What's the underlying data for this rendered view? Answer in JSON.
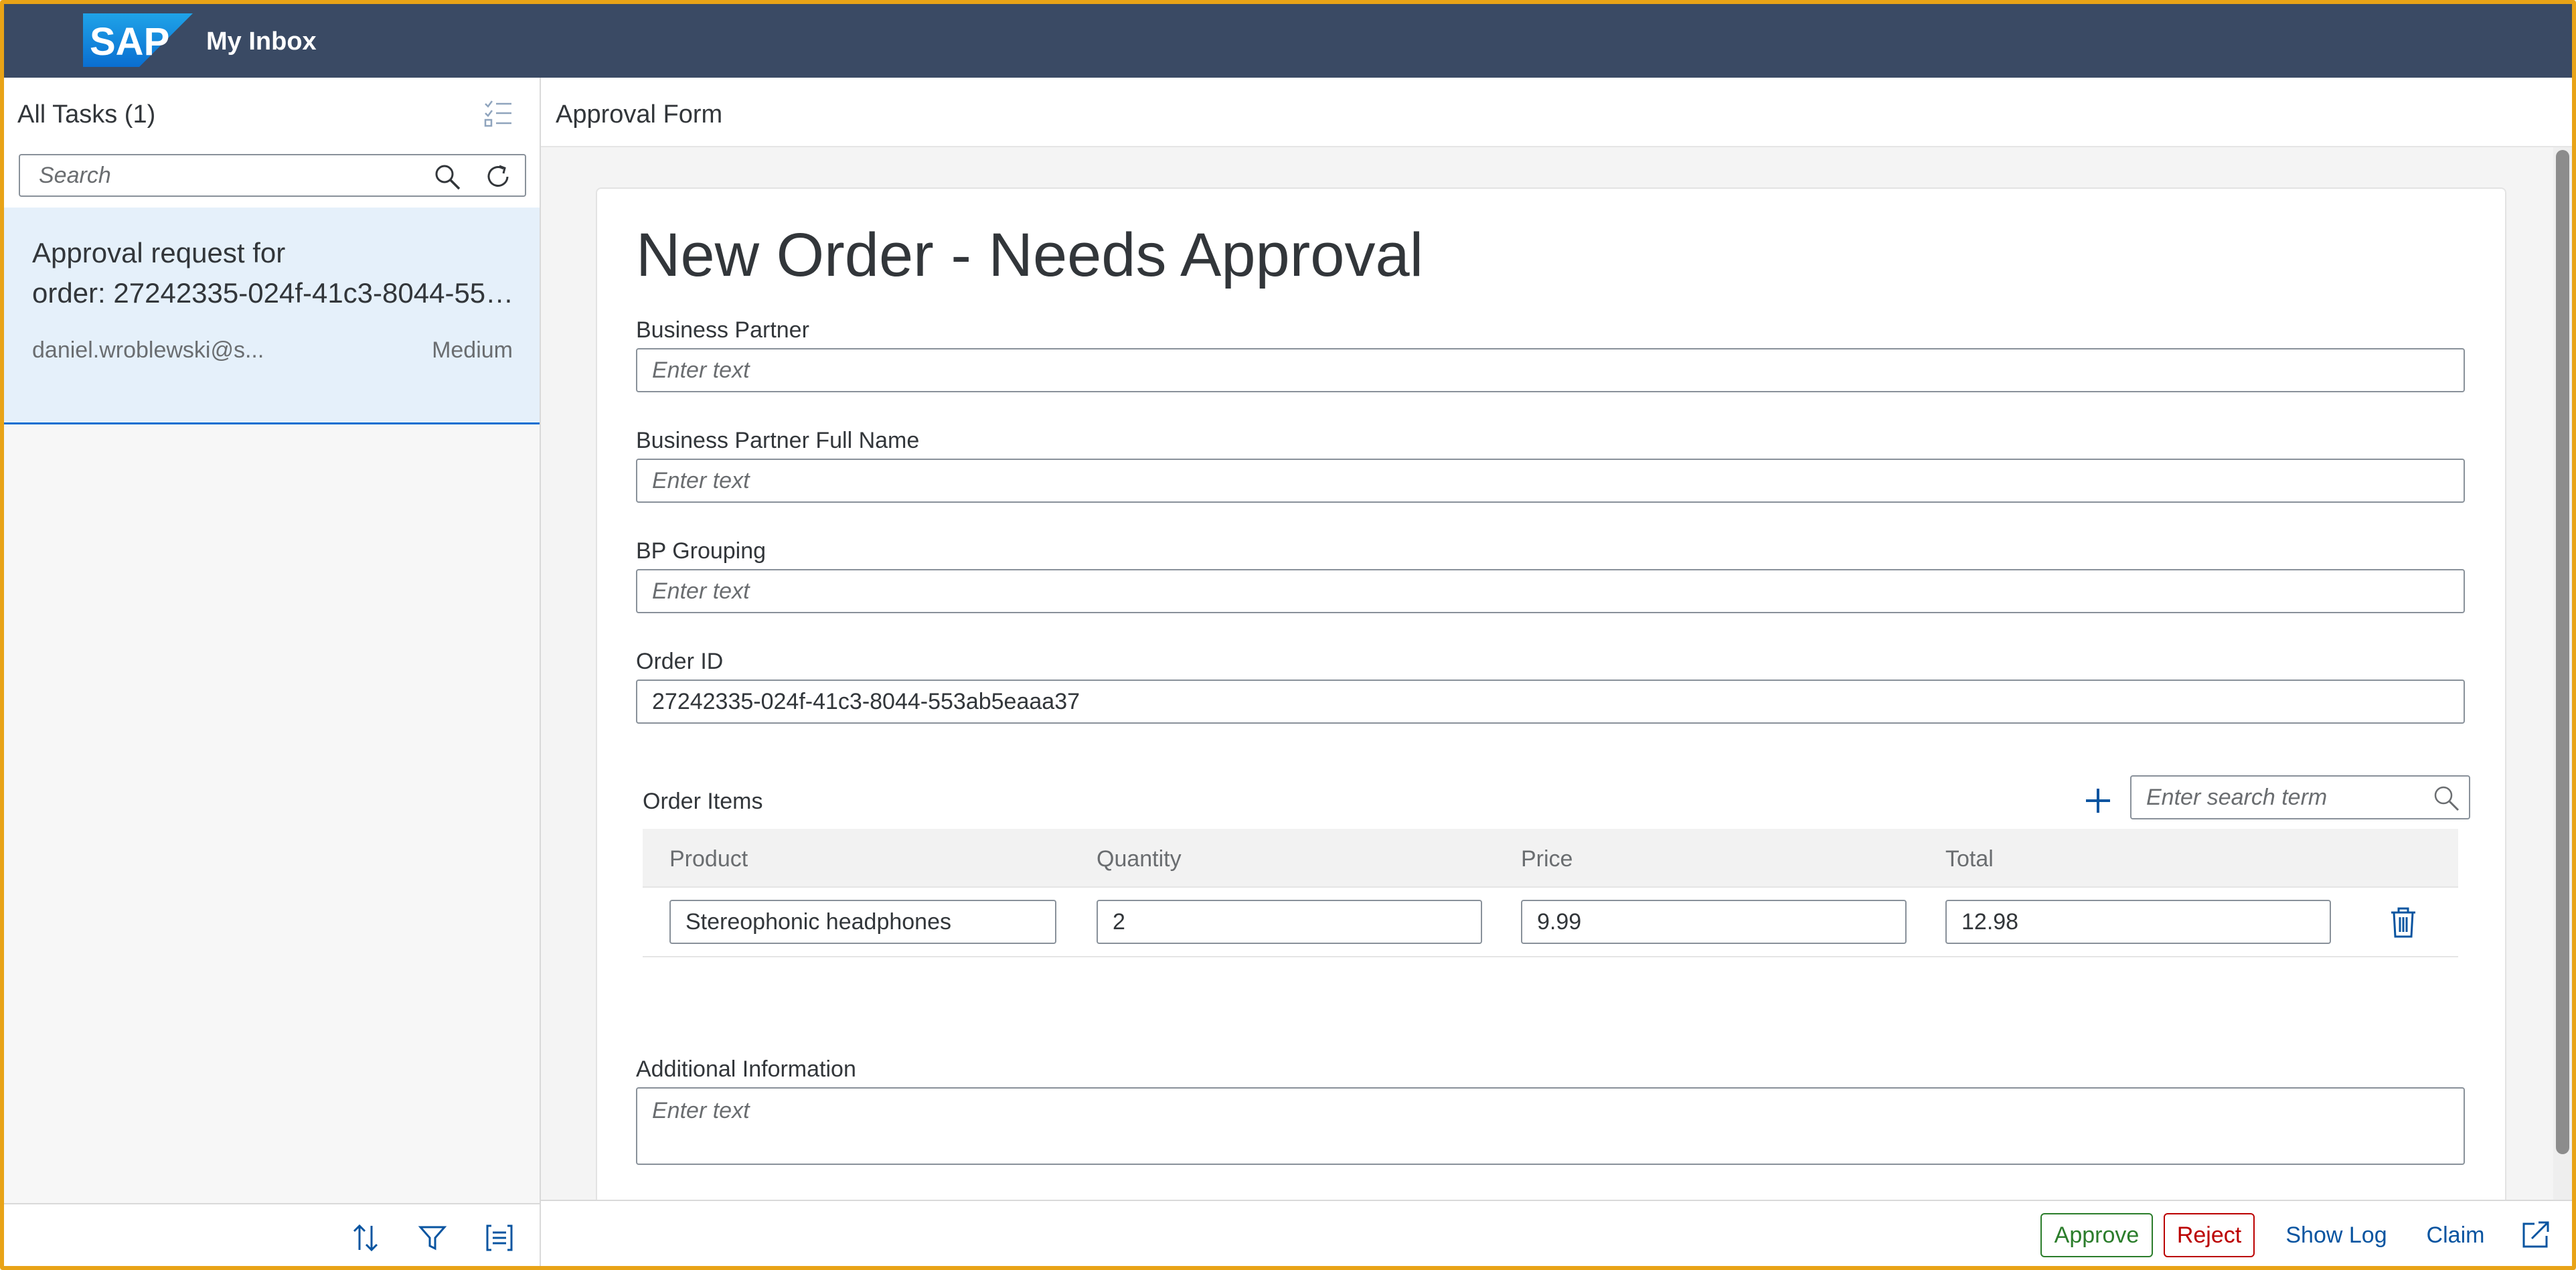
{
  "shell": {
    "logo_text": "SAP",
    "app_title": "My Inbox",
    "header_color": "#3a4a64",
    "accent_color": "#0a6ed1"
  },
  "master": {
    "title": "All Tasks (1)",
    "search_placeholder": "Search",
    "tasks": [
      {
        "title_line1": "Approval request for",
        "title_line2": "order: 27242335-024f-41c3-8044-553ab5eaaa37",
        "created_by": "daniel.wroblewski@s...",
        "priority": "Medium",
        "selected": true
      }
    ],
    "footer_icons": [
      "sort-icon",
      "filter-icon",
      "group-list-icon"
    ]
  },
  "detail": {
    "header_title": "Approval Form",
    "form": {
      "heading": "New Order - Needs Approval",
      "business_partner": {
        "label": "Business Partner",
        "placeholder": "Enter text",
        "value": ""
      },
      "business_partner_full_name": {
        "label": "Business Partner Full Name",
        "placeholder": "Enter text",
        "value": ""
      },
      "bp_grouping": {
        "label": "BP Grouping",
        "placeholder": "Enter text",
        "value": ""
      },
      "order_id": {
        "label": "Order ID",
        "placeholder": "Enter text",
        "value": "27242335-024f-41c3-8044-553ab5eaaa37"
      },
      "order_items": {
        "title": "Order Items",
        "search_placeholder": "Enter search term",
        "columns": [
          "Product",
          "Quantity",
          "Price",
          "Total"
        ],
        "rows": [
          {
            "product": "Stereophonic headphones",
            "quantity": "2",
            "price": "9.99",
            "total": "12.98"
          }
        ]
      },
      "additional_information": {
        "label": "Additional Information",
        "placeholder": "Enter text",
        "value": ""
      }
    },
    "footer": {
      "approve_label": "Approve",
      "reject_label": "Reject",
      "show_log_label": "Show Log",
      "claim_label": "Claim"
    }
  }
}
